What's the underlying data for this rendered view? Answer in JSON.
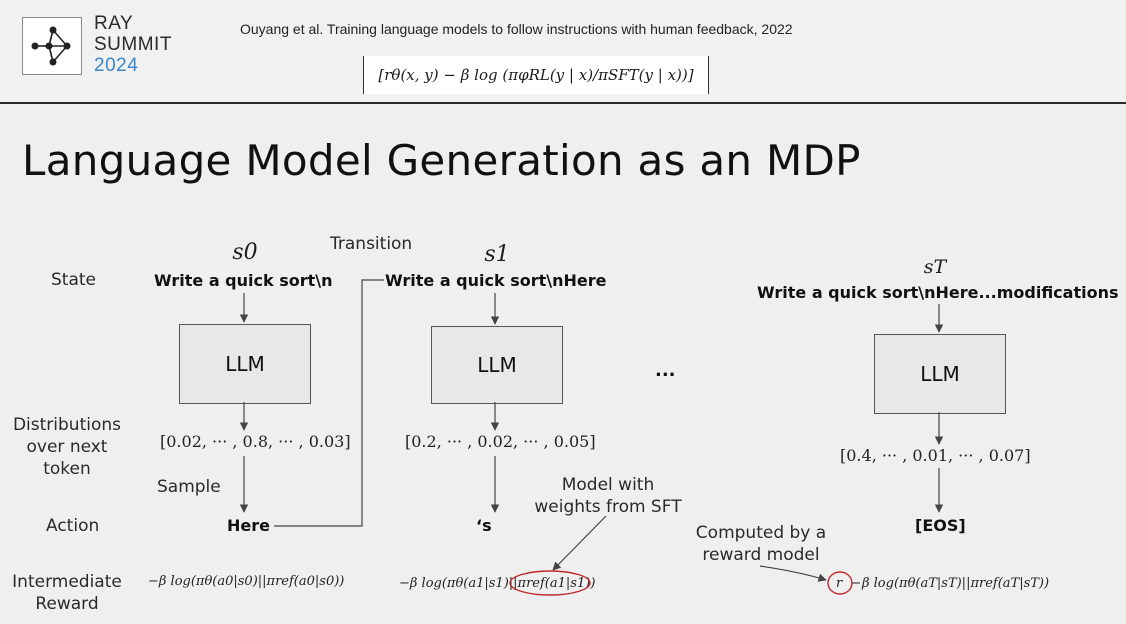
{
  "header": {
    "logo": {
      "line1": "RAY",
      "line2": "SUMMIT",
      "year": "2024"
    },
    "citation": "Ouyang et al. Training language models to follow instructions with human feedback, 2022",
    "formula": "[rθ(x, y) − β log (πφRL(y | x)/πSFT(y | x))]"
  },
  "slide": {
    "title": "Language Model Generation as an MDP"
  },
  "row_labels": {
    "state": "State",
    "dist_line1": "Distributions",
    "dist_line2": "over next",
    "dist_line3": "token",
    "sample": "Sample",
    "action": "Action",
    "reward_line1": "Intermediate",
    "reward_line2": "Reward"
  },
  "transition_label": "Transition",
  "ellipsis": "...",
  "steps": [
    {
      "state_symbol": "s0",
      "state_text": "Write a quick sort\\n",
      "llm": "LLM",
      "distribution": "[0.02, ··· , 0.8, ··· , 0.03]",
      "action": "Here",
      "reward": "−β log(πθ(a0|s0)||πref(a0|s0))"
    },
    {
      "state_symbol": "s1",
      "state_text": "Write a quick sort\\nHere",
      "llm": "LLM",
      "distribution": "[0.2, ··· , 0.02, ··· , 0.05]",
      "action": "‘s",
      "reward_prefix": "−β log(πθ(a1|s1)||",
      "reward_ref": "πref(a1|s1)",
      "reward_suffix": ")"
    },
    {
      "state_symbol": "sT",
      "state_text": "Write a quick sort\\nHere...modifications",
      "llm": "LLM",
      "distribution": "[0.4, ··· , 0.01, ··· , 0.07]",
      "action": "[EOS]",
      "reward_r": "r",
      "reward_rest": "β log(πθ(aT|sT)||πref(aT|sT))"
    }
  ],
  "annotations": {
    "sft_line1": "Model with",
    "sft_line2": "weights from SFT",
    "reward_line1": "Computed by a",
    "reward_line2": "reward model"
  },
  "colors": {
    "accent_circle": "#c0272d",
    "logo_blue": "#3a86c8"
  }
}
